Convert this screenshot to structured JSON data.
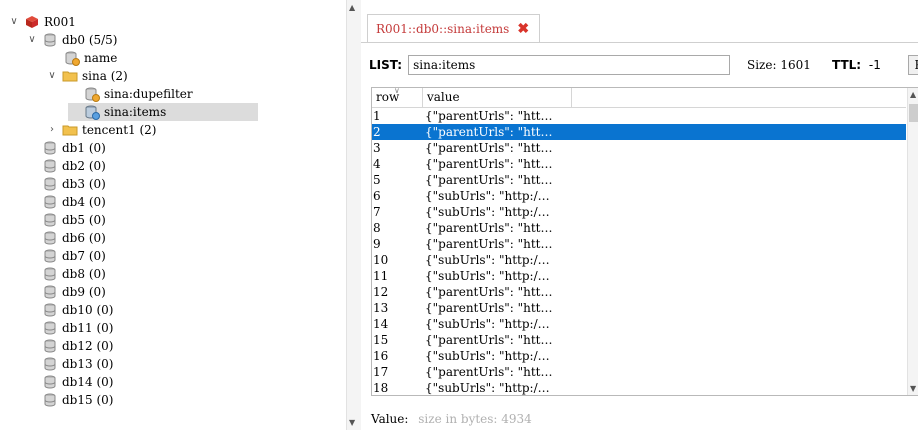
{
  "tree": {
    "root": {
      "label": "R001"
    },
    "db0": {
      "label": "db0  (5/5)"
    },
    "items": [
      {
        "label": "name"
      },
      {
        "label": "sina (2)"
      },
      {
        "label": "sina:dupefilter"
      },
      {
        "label": "sina:items"
      },
      {
        "label": "tencent1 (2)"
      }
    ],
    "dbs": [
      {
        "label": "db1  (0)"
      },
      {
        "label": "db2  (0)"
      },
      {
        "label": "db3  (0)"
      },
      {
        "label": "db4  (0)"
      },
      {
        "label": "db5  (0)"
      },
      {
        "label": "db6  (0)"
      },
      {
        "label": "db7  (0)"
      },
      {
        "label": "db8  (0)"
      },
      {
        "label": "db9  (0)"
      },
      {
        "label": "db10  (0)"
      },
      {
        "label": "db11  (0)"
      },
      {
        "label": "db12  (0)"
      },
      {
        "label": "db13  (0)"
      },
      {
        "label": "db14  (0)"
      },
      {
        "label": "db15  (0)"
      }
    ]
  },
  "tab": {
    "title": "R001::db0::sina:items"
  },
  "key": {
    "type_label": "LIST:",
    "name": "sina:items",
    "size_label": "Size: 1601",
    "ttl_label": "TTL:",
    "ttl_value": "-1",
    "button_label": "R"
  },
  "grid": {
    "columns": [
      "row",
      "value"
    ],
    "selected_row": 2,
    "rows": [
      {
        "n": "1",
        "v": "{\"parentUrls\": \"htt…"
      },
      {
        "n": "2",
        "v": "{\"parentUrls\": \"htt…"
      },
      {
        "n": "3",
        "v": "{\"parentUrls\": \"htt…"
      },
      {
        "n": "4",
        "v": "{\"parentUrls\": \"htt…"
      },
      {
        "n": "5",
        "v": "{\"parentUrls\": \"htt…"
      },
      {
        "n": "6",
        "v": "{\"subUrls\": \"http:/…"
      },
      {
        "n": "7",
        "v": "{\"subUrls\": \"http:/…"
      },
      {
        "n": "8",
        "v": "{\"parentUrls\": \"htt…"
      },
      {
        "n": "9",
        "v": "{\"parentUrls\": \"htt…"
      },
      {
        "n": "10",
        "v": "{\"subUrls\": \"http:/…"
      },
      {
        "n": "11",
        "v": "{\"subUrls\": \"http:/…"
      },
      {
        "n": "12",
        "v": "{\"parentUrls\": \"htt…"
      },
      {
        "n": "13",
        "v": "{\"parentUrls\": \"htt…"
      },
      {
        "n": "14",
        "v": "{\"subUrls\": \"http:/…"
      },
      {
        "n": "15",
        "v": "{\"parentUrls\": \"htt…"
      },
      {
        "n": "16",
        "v": "{\"subUrls\": \"http:/…"
      },
      {
        "n": "17",
        "v": "{\"parentUrls\": \"htt…"
      },
      {
        "n": "18",
        "v": "{\"subUrls\": \"http:/…"
      }
    ]
  },
  "value_bar": {
    "label": "Value:",
    "placeholder": "size in bytes: 4934"
  },
  "colors": {
    "selection": "#0a74d0",
    "tab_text": "#c43a3a",
    "close": "#d9342b",
    "server_icon": "#cc2b2b",
    "folder": "#f2c14e"
  }
}
